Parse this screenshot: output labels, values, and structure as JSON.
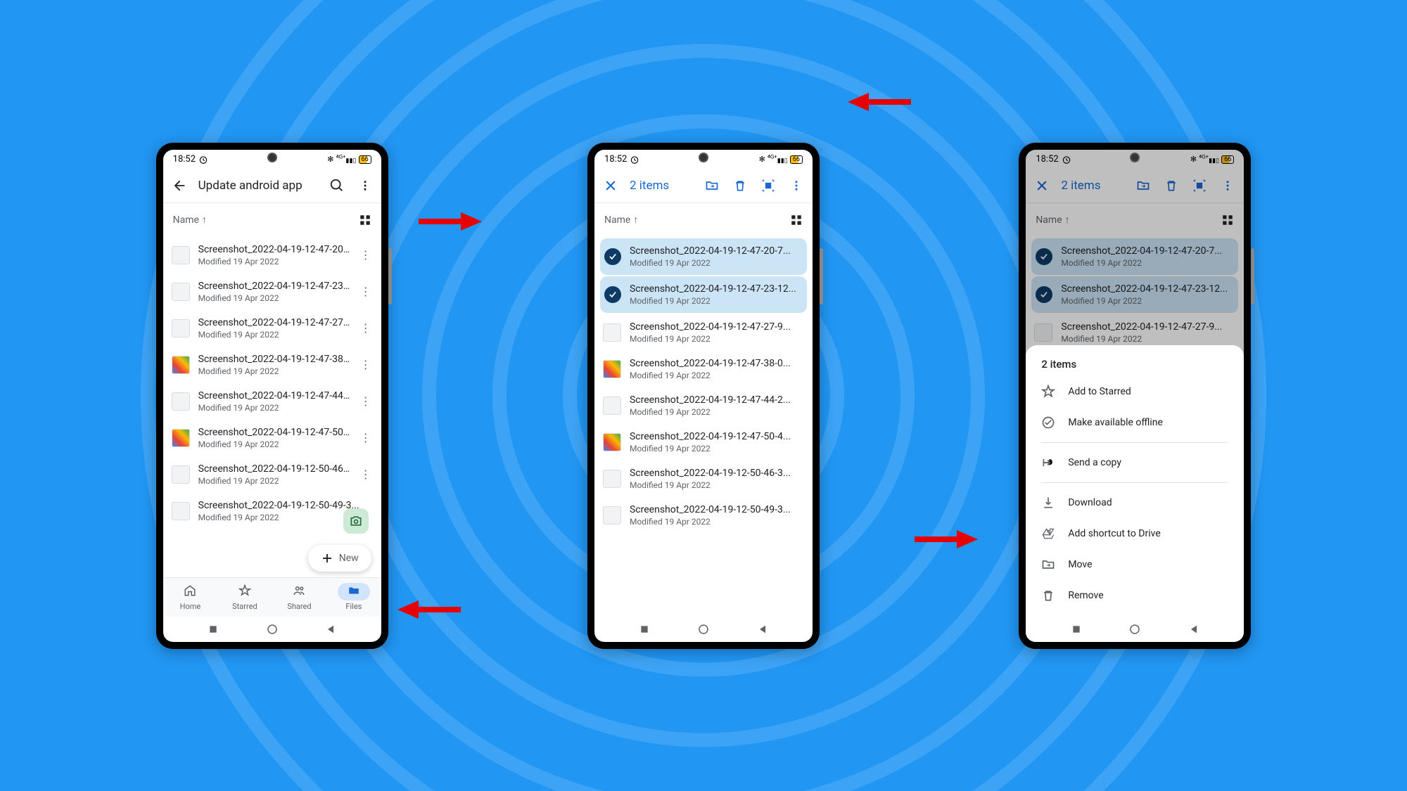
{
  "status": {
    "time": "18:52",
    "battery": "66"
  },
  "phone1": {
    "title": "Update android app",
    "sort": "Name",
    "fab": "New",
    "nav": {
      "home": "Home",
      "starred": "Starred",
      "shared": "Shared",
      "files": "Files"
    }
  },
  "phone2": {
    "title": "2 items",
    "sort": "Name"
  },
  "phone3": {
    "title": "2 items",
    "sort": "Name",
    "sheet": {
      "header": "2 items",
      "add_starred": "Add to Starred",
      "offline": "Make available offline",
      "send_copy": "Send a copy",
      "download": "Download",
      "shortcut": "Add shortcut to Drive",
      "move": "Move",
      "remove": "Remove"
    }
  },
  "files": [
    {
      "name": "Screenshot_2022-04-19-12-47-20-7...",
      "mod": "Modified 19 Apr 2022"
    },
    {
      "name": "Screenshot_2022-04-19-12-47-23-12...",
      "mod": "Modified 19 Apr 2022"
    },
    {
      "name": "Screenshot_2022-04-19-12-47-27-9...",
      "mod": "Modified 19 Apr 2022"
    },
    {
      "name": "Screenshot_2022-04-19-12-47-38-0...",
      "mod": "Modified 19 Apr 2022"
    },
    {
      "name": "Screenshot_2022-04-19-12-47-44-2...",
      "mod": "Modified 19 Apr 2022"
    },
    {
      "name": "Screenshot_2022-04-19-12-47-50-4...",
      "mod": "Modified 19 Apr 2022"
    },
    {
      "name": "Screenshot_2022-04-19-12-50-46-3...",
      "mod": "Modified 19 Apr 2022"
    },
    {
      "name": "Screenshot_2022-04-19-12-50-49-3...",
      "mod": "Modified 19 Apr 2022"
    }
  ]
}
